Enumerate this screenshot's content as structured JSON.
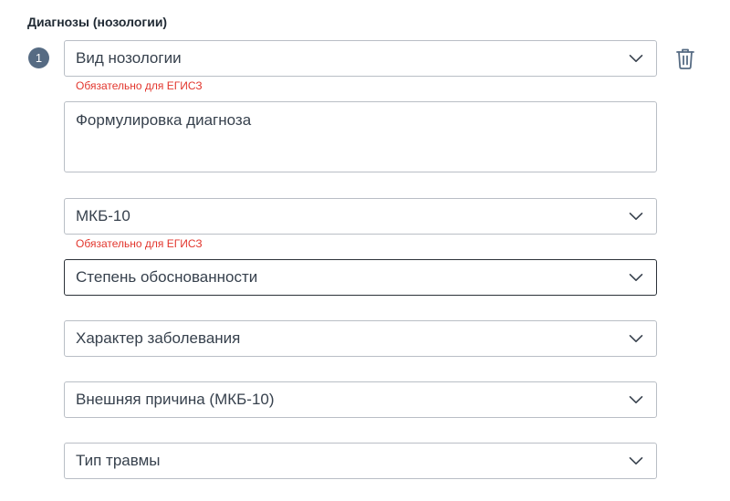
{
  "section": {
    "title": "Диагнозы (нозологии)"
  },
  "diagnosis": {
    "number": "1",
    "nosology_type": {
      "label": "Вид нозологии",
      "hint": "Обязательно для ЕГИСЗ"
    },
    "formulation": {
      "placeholder": "Формулировка диагноза"
    },
    "icd10": {
      "label": "МКБ-10",
      "hint": "Обязательно для ЕГИСЗ"
    },
    "certainty": {
      "label": "Степень обоснованности"
    },
    "disease_nature": {
      "label": "Характер заболевания"
    },
    "external_cause": {
      "label": "Внешняя причина (МКБ-10)"
    },
    "injury_type": {
      "label": "Тип травмы"
    }
  },
  "icons": {
    "delete": "trash-icon",
    "dropdown": "chevron-down-icon"
  },
  "colors": {
    "badge": "#566b83",
    "hint_error": "#e2362d",
    "border": "#b9bec5",
    "border_focused": "#2b3138"
  }
}
